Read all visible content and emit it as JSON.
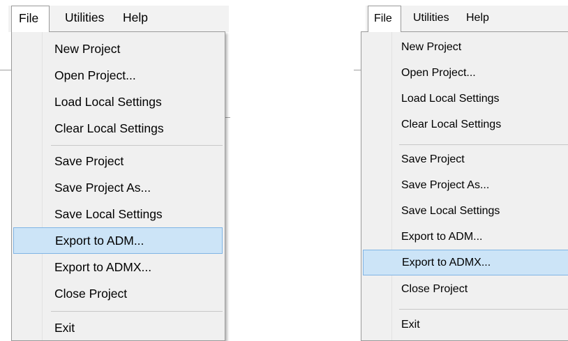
{
  "left_panel": {
    "menubar": {
      "file": "File",
      "utilities": "Utilities",
      "help": "Help"
    },
    "file_menu": {
      "items": [
        "New Project",
        "Open Project...",
        "Load Local Settings",
        "Clear Local Settings",
        "Save Project",
        "Save Project As...",
        "Save Local Settings",
        "Export to ADM...",
        "Export to ADMX...",
        "Close Project",
        "Exit"
      ],
      "highlighted_item": "Export to ADM..."
    }
  },
  "right_panel": {
    "menubar": {
      "file": "File",
      "utilities": "Utilities",
      "help": "Help"
    },
    "file_menu": {
      "items": [
        "New Project",
        "Open Project...",
        "Load Local Settings",
        "Clear Local Settings",
        "Save Project",
        "Save Project As...",
        "Save Local Settings",
        "Export to ADM...",
        "Export to ADMX...",
        "Close Project",
        "Exit"
      ],
      "highlighted_item": "Export to ADMX..."
    }
  },
  "colors": {
    "highlight_fill": "#cce4f7",
    "highlight_border": "#7fb4e5",
    "menu_background": "#f0f0f0",
    "menubar_background": "#f2f2f2"
  }
}
